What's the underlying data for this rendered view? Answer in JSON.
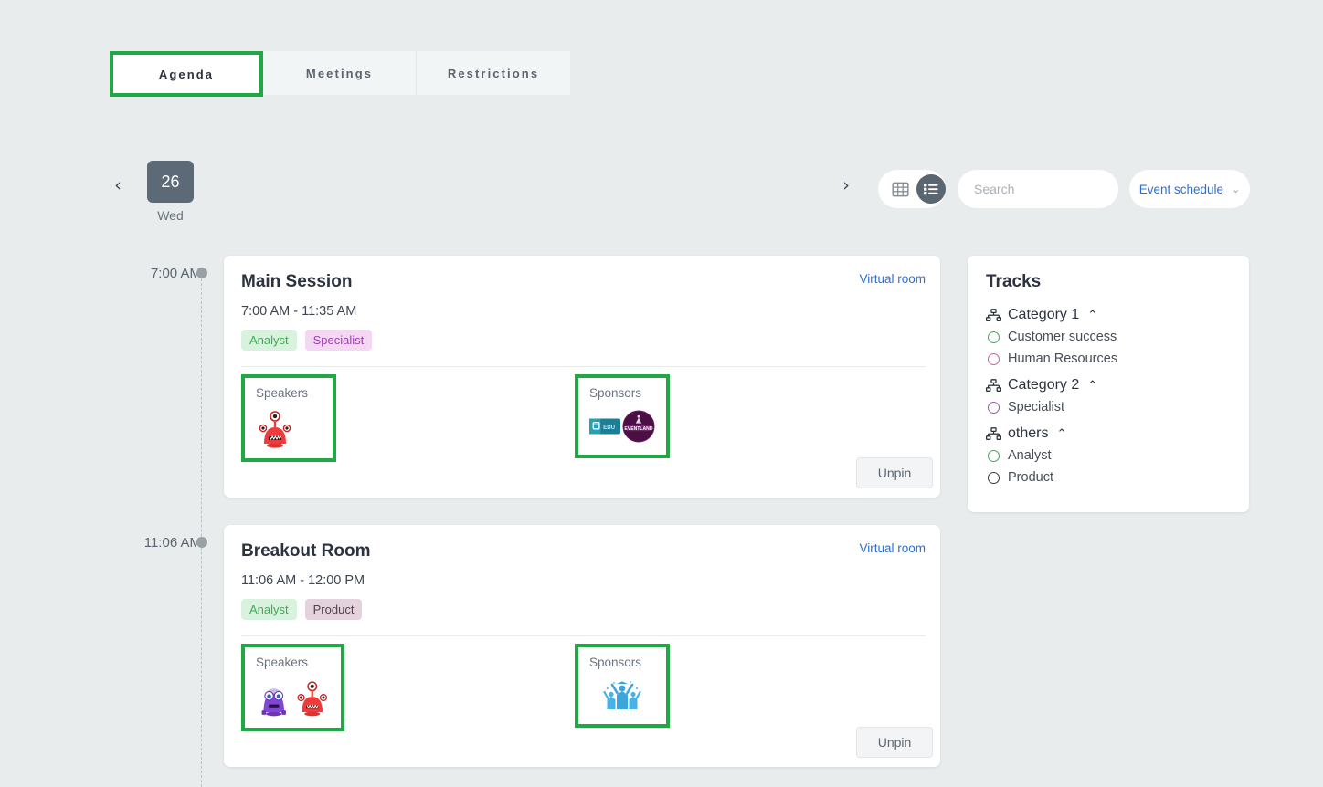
{
  "theme": {
    "page_bg": "#e8ecec",
    "accent_green": "#22a745",
    "link_blue": "#2e6fd1",
    "slate": "#5c6976"
  },
  "tabs": [
    {
      "label": "Agenda",
      "active": true
    },
    {
      "label": "Meetings",
      "active": false
    },
    {
      "label": "Restrictions",
      "active": false
    }
  ],
  "toolbar": {
    "prev_arrow": "‹",
    "next_arrow": "›",
    "date": {
      "day_number": "26",
      "weekday": "Wed"
    },
    "view_grid_icon": "grid-view-icon",
    "view_list_icon": "list-view-icon",
    "active_view": "list",
    "search": {
      "value": "",
      "placeholder": "Search",
      "icon": "search-icon"
    },
    "schedule_dropdown": {
      "label": "Event schedule",
      "chevron": "⌄"
    }
  },
  "timeline": [
    {
      "time": "7:00 AM"
    },
    {
      "time": "11:06 AM"
    }
  ],
  "sessions": [
    {
      "title": "Main Session",
      "time": "7:00 AM - 11:35 AM",
      "virtual_room_label": "Virtual room",
      "tags": [
        {
          "label": "Analyst",
          "bg": "#d9f2de",
          "fg": "#3faa56"
        },
        {
          "label": "Specialist",
          "bg": "#f3d7f3",
          "fg": "#a13fb0"
        }
      ],
      "speakers_label": "Speakers",
      "sponsors_label": "Sponsors",
      "speakers": [
        "red-monster-avatar"
      ],
      "sponsors": [
        "teal-rect-logo",
        "eventland-circle-logo"
      ],
      "unpin_label": "Unpin"
    },
    {
      "title": "Breakout Room",
      "time": "11:06 AM - 12:00 PM",
      "virtual_room_label": "Virtual room",
      "tags": [
        {
          "label": "Analyst",
          "bg": "#d9f2de",
          "fg": "#3faa56"
        },
        {
          "label": "Product",
          "bg": "#e4d3dd",
          "fg": "#52414c"
        }
      ],
      "speakers_label": "Speakers",
      "sponsors_label": "Sponsors",
      "speakers": [
        "purple-monster-avatar",
        "red-monster-avatar"
      ],
      "sponsors": [
        "blue-graduates-logo"
      ],
      "unpin_label": "Unpin"
    }
  ],
  "tracks": {
    "title": "Tracks",
    "groups": [
      {
        "label": "Category 1",
        "icon": "sitemap-icon",
        "chevron": "⌃",
        "items": [
          {
            "label": "Customer success",
            "color": "#3faa56"
          },
          {
            "label": "Human Resources",
            "color": "#cc5fa6"
          }
        ]
      },
      {
        "label": "Category 2",
        "icon": "sitemap-icon",
        "chevron": "⌃",
        "items": [
          {
            "label": "Specialist",
            "color": "#a94fbd"
          }
        ]
      },
      {
        "label": "others",
        "icon": "sitemap-icon",
        "chevron": "⌃",
        "items": [
          {
            "label": "Analyst",
            "color": "#3faa56"
          },
          {
            "label": "Product",
            "color": "#3b3344"
          }
        ]
      }
    ]
  }
}
